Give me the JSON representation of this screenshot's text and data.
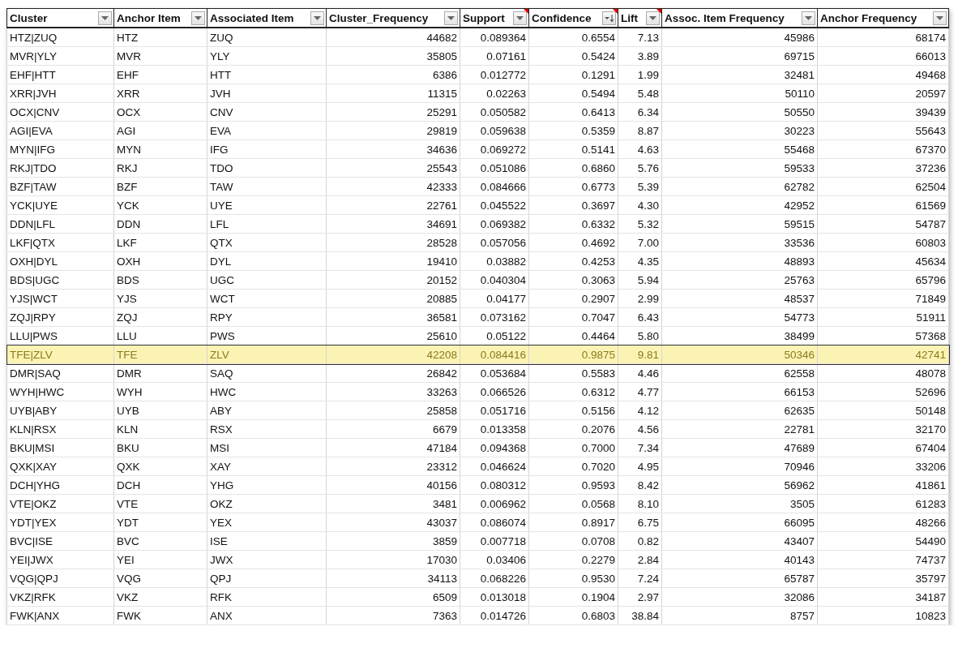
{
  "table": {
    "columns": [
      {
        "label": "Cluster",
        "numeric": false,
        "sorted": false,
        "comment": false
      },
      {
        "label": "Anchor Item",
        "numeric": false,
        "sorted": false,
        "comment": false
      },
      {
        "label": "Associated Item",
        "numeric": false,
        "sorted": false,
        "comment": false
      },
      {
        "label": "Cluster_Frequency",
        "numeric": true,
        "sorted": false,
        "comment": false
      },
      {
        "label": "Support",
        "numeric": true,
        "sorted": false,
        "comment": true
      },
      {
        "label": "Confidence",
        "numeric": true,
        "sorted": true,
        "comment": true
      },
      {
        "label": "Lift",
        "numeric": true,
        "sorted": false,
        "comment": true
      },
      {
        "label": "Assoc. Item Frequency",
        "numeric": true,
        "sorted": false,
        "comment": false
      },
      {
        "label": "Anchor Frequency",
        "numeric": true,
        "sorted": false,
        "comment": false
      }
    ],
    "rows": [
      {
        "selected": false,
        "cells": [
          "HTZ|ZUQ",
          "HTZ",
          "ZUQ",
          "44682",
          "0.089364",
          "0.6554",
          "7.13",
          "45986",
          "68174"
        ]
      },
      {
        "selected": false,
        "cells": [
          "MVR|YLY",
          "MVR",
          "YLY",
          "35805",
          "0.07161",
          "0.5424",
          "3.89",
          "69715",
          "66013"
        ]
      },
      {
        "selected": false,
        "cells": [
          "EHF|HTT",
          "EHF",
          "HTT",
          "6386",
          "0.012772",
          "0.1291",
          "1.99",
          "32481",
          "49468"
        ]
      },
      {
        "selected": false,
        "cells": [
          "XRR|JVH",
          "XRR",
          "JVH",
          "11315",
          "0.02263",
          "0.5494",
          "5.48",
          "50110",
          "20597"
        ]
      },
      {
        "selected": false,
        "cells": [
          "OCX|CNV",
          "OCX",
          "CNV",
          "25291",
          "0.050582",
          "0.6413",
          "6.34",
          "50550",
          "39439"
        ]
      },
      {
        "selected": false,
        "cells": [
          "AGI|EVA",
          "AGI",
          "EVA",
          "29819",
          "0.059638",
          "0.5359",
          "8.87",
          "30223",
          "55643"
        ]
      },
      {
        "selected": false,
        "cells": [
          "MYN|IFG",
          "MYN",
          "IFG",
          "34636",
          "0.069272",
          "0.5141",
          "4.63",
          "55468",
          "67370"
        ]
      },
      {
        "selected": false,
        "cells": [
          "RKJ|TDO",
          "RKJ",
          "TDO",
          "25543",
          "0.051086",
          "0.6860",
          "5.76",
          "59533",
          "37236"
        ]
      },
      {
        "selected": false,
        "cells": [
          "BZF|TAW",
          "BZF",
          "TAW",
          "42333",
          "0.084666",
          "0.6773",
          "5.39",
          "62782",
          "62504"
        ]
      },
      {
        "selected": false,
        "cells": [
          "YCK|UYE",
          "YCK",
          "UYE",
          "22761",
          "0.045522",
          "0.3697",
          "4.30",
          "42952",
          "61569"
        ]
      },
      {
        "selected": false,
        "cells": [
          "DDN|LFL",
          "DDN",
          "LFL",
          "34691",
          "0.069382",
          "0.6332",
          "5.32",
          "59515",
          "54787"
        ]
      },
      {
        "selected": false,
        "cells": [
          "LKF|QTX",
          "LKF",
          "QTX",
          "28528",
          "0.057056",
          "0.4692",
          "7.00",
          "33536",
          "60803"
        ]
      },
      {
        "selected": false,
        "cells": [
          "OXH|DYL",
          "OXH",
          "DYL",
          "19410",
          "0.03882",
          "0.4253",
          "4.35",
          "48893",
          "45634"
        ]
      },
      {
        "selected": false,
        "cells": [
          "BDS|UGC",
          "BDS",
          "UGC",
          "20152",
          "0.040304",
          "0.3063",
          "5.94",
          "25763",
          "65796"
        ]
      },
      {
        "selected": false,
        "cells": [
          "YJS|WCT",
          "YJS",
          "WCT",
          "20885",
          "0.04177",
          "0.2907",
          "2.99",
          "48537",
          "71849"
        ]
      },
      {
        "selected": false,
        "cells": [
          "ZQJ|RPY",
          "ZQJ",
          "RPY",
          "36581",
          "0.073162",
          "0.7047",
          "6.43",
          "54773",
          "51911"
        ]
      },
      {
        "selected": false,
        "cells": [
          "LLU|PWS",
          "LLU",
          "PWS",
          "25610",
          "0.05122",
          "0.4464",
          "5.80",
          "38499",
          "57368"
        ]
      },
      {
        "selected": true,
        "cells": [
          "TFE|ZLV",
          "TFE",
          "ZLV",
          "42208",
          "0.084416",
          "0.9875",
          "9.81",
          "50346",
          "42741"
        ]
      },
      {
        "selected": false,
        "cells": [
          "DMR|SAQ",
          "DMR",
          "SAQ",
          "26842",
          "0.053684",
          "0.5583",
          "4.46",
          "62558",
          "48078"
        ]
      },
      {
        "selected": false,
        "cells": [
          "WYH|HWC",
          "WYH",
          "HWC",
          "33263",
          "0.066526",
          "0.6312",
          "4.77",
          "66153",
          "52696"
        ]
      },
      {
        "selected": false,
        "cells": [
          "UYB|ABY",
          "UYB",
          "ABY",
          "25858",
          "0.051716",
          "0.5156",
          "4.12",
          "62635",
          "50148"
        ]
      },
      {
        "selected": false,
        "cells": [
          "KLN|RSX",
          "KLN",
          "RSX",
          "6679",
          "0.013358",
          "0.2076",
          "4.56",
          "22781",
          "32170"
        ]
      },
      {
        "selected": false,
        "cells": [
          "BKU|MSI",
          "BKU",
          "MSI",
          "47184",
          "0.094368",
          "0.7000",
          "7.34",
          "47689",
          "67404"
        ]
      },
      {
        "selected": false,
        "cells": [
          "QXK|XAY",
          "QXK",
          "XAY",
          "23312",
          "0.046624",
          "0.7020",
          "4.95",
          "70946",
          "33206"
        ]
      },
      {
        "selected": false,
        "cells": [
          "DCH|YHG",
          "DCH",
          "YHG",
          "40156",
          "0.080312",
          "0.9593",
          "8.42",
          "56962",
          "41861"
        ]
      },
      {
        "selected": false,
        "cells": [
          "VTE|OKZ",
          "VTE",
          "OKZ",
          "3481",
          "0.006962",
          "0.0568",
          "8.10",
          "3505",
          "61283"
        ]
      },
      {
        "selected": false,
        "cells": [
          "YDT|YEX",
          "YDT",
          "YEX",
          "43037",
          "0.086074",
          "0.8917",
          "6.75",
          "66095",
          "48266"
        ]
      },
      {
        "selected": false,
        "cells": [
          "BVC|ISE",
          "BVC",
          "ISE",
          "3859",
          "0.007718",
          "0.0708",
          "0.82",
          "43407",
          "54490"
        ]
      },
      {
        "selected": false,
        "cells": [
          "YEI|JWX",
          "YEI",
          "JWX",
          "17030",
          "0.03406",
          "0.2279",
          "2.84",
          "40143",
          "74737"
        ]
      },
      {
        "selected": false,
        "cells": [
          "VQG|QPJ",
          "VQG",
          "QPJ",
          "34113",
          "0.068226",
          "0.9530",
          "7.24",
          "65787",
          "35797"
        ]
      },
      {
        "selected": false,
        "cells": [
          "VKZ|RFK",
          "VKZ",
          "RFK",
          "6509",
          "0.013018",
          "0.1904",
          "2.97",
          "32086",
          "34187"
        ]
      },
      {
        "selected": false,
        "cells": [
          "FWK|ANX",
          "FWK",
          "ANX",
          "7363",
          "0.014726",
          "0.6803",
          "38.84",
          "8757",
          "10823"
        ]
      }
    ]
  }
}
